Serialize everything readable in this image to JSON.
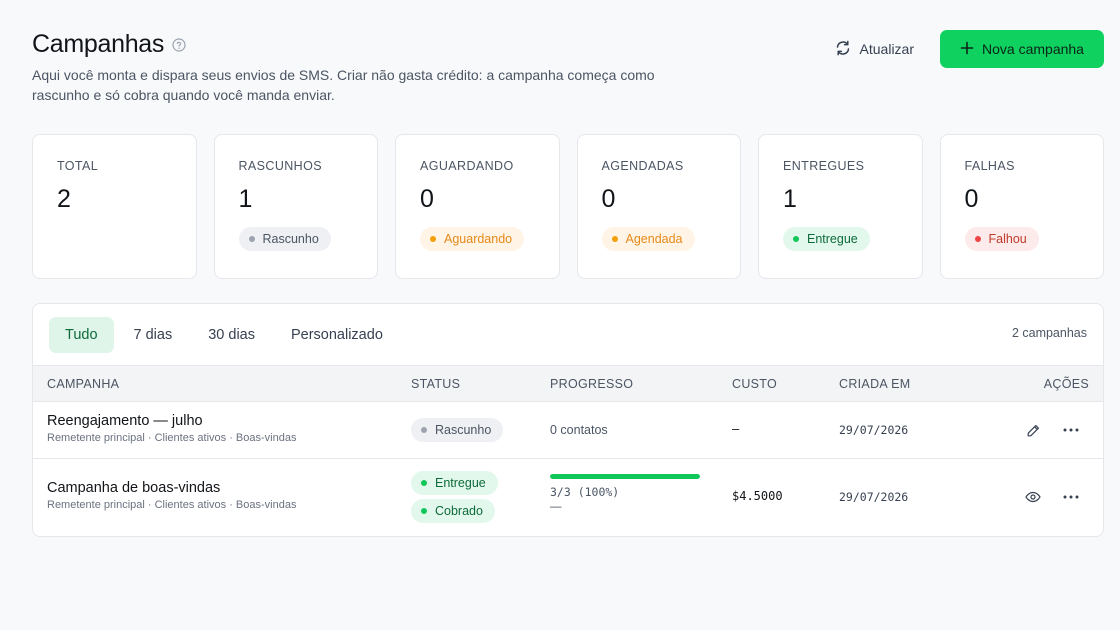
{
  "header": {
    "title": "Campanhas",
    "help_icon": "help-circle-icon",
    "subtitle": "Aqui você monta e dispara seus envios de SMS. Criar não gasta crédito: a campanha começa como rascunho e só cobra quando você manda enviar.",
    "refresh_label": "Atualizar",
    "new_label": "Nova campanha",
    "accent_color": "#0fd15f"
  },
  "stats": [
    {
      "label": "TOTAL",
      "value": "2"
    },
    {
      "label": "RASCUNHOS",
      "value": "1",
      "badge": "Rascunho",
      "badge_color": "gray"
    },
    {
      "label": "AGUARDANDO",
      "value": "0",
      "badge": "Aguardando",
      "badge_color": "orange"
    },
    {
      "label": "AGENDADAS",
      "value": "0",
      "badge": "Agendada",
      "badge_color": "orange"
    },
    {
      "label": "ENTREGUES",
      "value": "1",
      "badge": "Entregue",
      "badge_color": "green"
    },
    {
      "label": "FALHAS",
      "value": "0",
      "badge": "Falhou",
      "badge_color": "red"
    }
  ],
  "filters": {
    "tabs": [
      "Tudo",
      "7 dias",
      "30 dias",
      "Personalizado"
    ],
    "active": "Tudo",
    "count": "2 campanhas"
  },
  "table": {
    "columns": [
      "CAMPANHA",
      "STATUS",
      "PROGRESSO",
      "CUSTO",
      "CRIADA EM",
      "AÇÕES"
    ],
    "rows": [
      {
        "name": "Reengajamento — julho",
        "meta": "Remetente principal · Clientes ativos · Boas-vindas",
        "status": [
          "Rascunho"
        ],
        "progress_text": "0 contatos",
        "cost": "—",
        "created": "29/07/2026",
        "actions": [
          "pencil-icon",
          "more-horizontal-icon"
        ]
      },
      {
        "name": "Campanha de boas-vindas",
        "meta": "Remetente principal · Clientes ativos · Boas-vindas",
        "status": [
          "Entregue",
          "Cobrado"
        ],
        "progress_fraction": 1.0,
        "progress_text": "3/3 (100%)",
        "progress_sub": "—",
        "cost": "$4.5000",
        "created": "29/07/2026",
        "actions": [
          "eye-icon",
          "more-horizontal-icon"
        ]
      }
    ]
  }
}
